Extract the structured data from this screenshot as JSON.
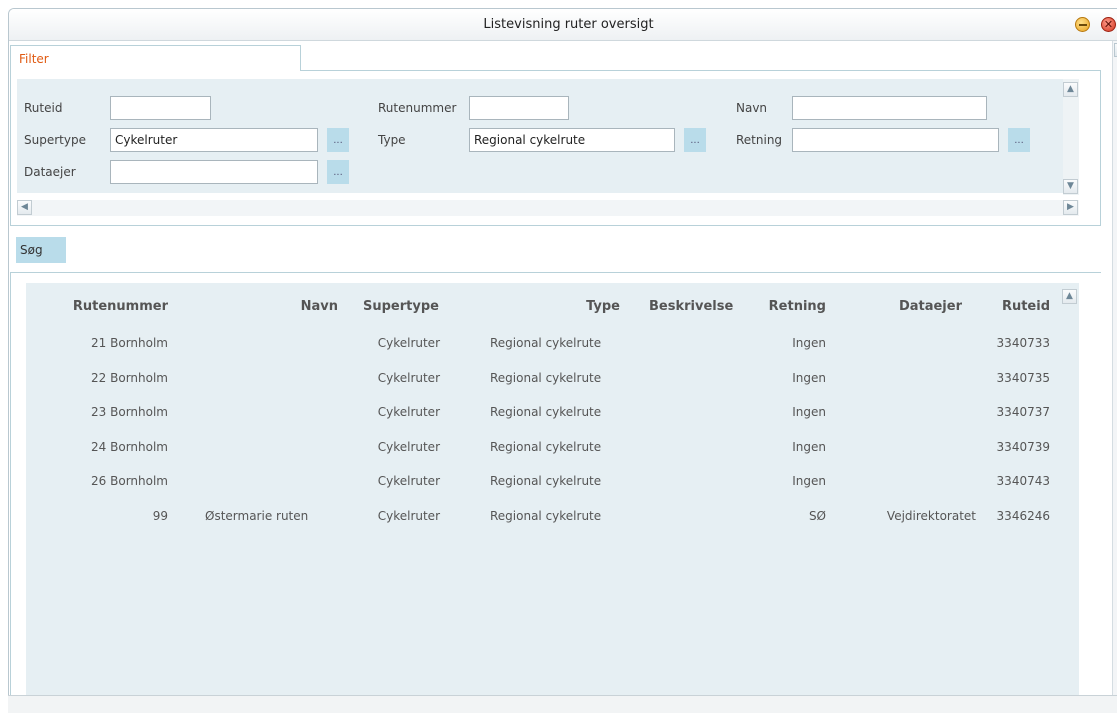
{
  "window": {
    "title": "Listevisning ruter oversigt"
  },
  "filter": {
    "tab_label": "Filter",
    "fields": {
      "ruteid": {
        "label": "Ruteid",
        "value": ""
      },
      "rutenummer": {
        "label": "Rutenummer",
        "value": ""
      },
      "navn": {
        "label": "Navn",
        "value": ""
      },
      "supertype": {
        "label": "Supertype",
        "value": "Cykelruter"
      },
      "type": {
        "label": "Type",
        "value": "Regional cykelrute"
      },
      "retning": {
        "label": "Retning",
        "value": ""
      },
      "dataejer": {
        "label": "Dataejer",
        "value": ""
      }
    },
    "picker_label": "..."
  },
  "search_button": {
    "label": "Søg"
  },
  "results": {
    "columns": [
      "Rutenummer",
      "Navn",
      "Supertype",
      "Type",
      "Beskrivelse",
      "Retning",
      "Dataejer",
      "Ruteid"
    ],
    "rows": [
      {
        "rutenummer": "21 Bornholm",
        "navn": "",
        "supertype": "Cykelruter",
        "type": "Regional cykelrute",
        "beskrivelse": "",
        "retning": "Ingen",
        "dataejer": "",
        "ruteid": "3340733"
      },
      {
        "rutenummer": "22 Bornholm",
        "navn": "",
        "supertype": "Cykelruter",
        "type": "Regional cykelrute",
        "beskrivelse": "",
        "retning": "Ingen",
        "dataejer": "",
        "ruteid": "3340735"
      },
      {
        "rutenummer": "23 Bornholm",
        "navn": "",
        "supertype": "Cykelruter",
        "type": "Regional cykelrute",
        "beskrivelse": "",
        "retning": "Ingen",
        "dataejer": "",
        "ruteid": "3340737"
      },
      {
        "rutenummer": "24 Bornholm",
        "navn": "",
        "supertype": "Cykelruter",
        "type": "Regional cykelrute",
        "beskrivelse": "",
        "retning": "Ingen",
        "dataejer": "",
        "ruteid": "3340739"
      },
      {
        "rutenummer": "26 Bornholm",
        "navn": "",
        "supertype": "Cykelruter",
        "type": "Regional cykelrute",
        "beskrivelse": "",
        "retning": "Ingen",
        "dataejer": "",
        "ruteid": "3340743"
      },
      {
        "rutenummer": "99",
        "navn": "Østermarie ruten",
        "supertype": "Cykelruter",
        "type": "Regional cykelrute",
        "beskrivelse": "",
        "retning": "SØ",
        "dataejer": "Vejdirektoratet",
        "ruteid": "3346246"
      }
    ]
  },
  "icons": {
    "minimize": "minimize-icon",
    "close": "close-icon",
    "scroll_up": "chevron-up-icon",
    "scroll_down": "chevron-down-icon",
    "scroll_left": "chevron-left-icon",
    "scroll_right": "chevron-right-icon"
  },
  "colors": {
    "tab_text": "#e05a12",
    "panel_bg": "#e6eff3",
    "button_bg": "#b9dcea",
    "border": "#b8d1d9"
  }
}
